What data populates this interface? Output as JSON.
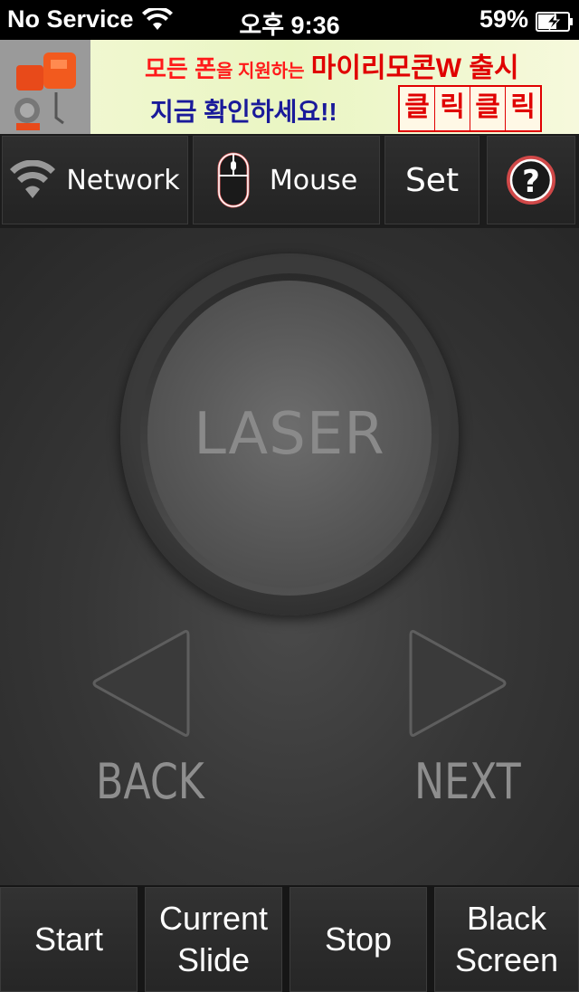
{
  "status_bar": {
    "carrier": "No Service",
    "time": "오후 9:36",
    "battery_pct": "59%"
  },
  "ad": {
    "line1_a": "모든 폰",
    "line1_b": "을 지원하는",
    "line1_c": "마이리모콘W 출시",
    "line2": "지금 확인하세요!!",
    "click_chars": [
      "클",
      "릭",
      "클",
      "릭"
    ]
  },
  "toolbar": {
    "network_label": "Network",
    "mouse_label": "Mouse",
    "set_label": "Set",
    "help_label": "?"
  },
  "laser": {
    "label": "LASER"
  },
  "nav": {
    "back_label": "BACK",
    "next_label": "NEXT"
  },
  "bottom_bar": {
    "start_label": "Start",
    "current_slide_label": "Current\nSlide",
    "stop_label": "Stop",
    "black_screen_label": "Black\nScreen"
  },
  "colors": {
    "accent_red": "#e00000",
    "ad_blue": "#1a1a9a",
    "text_gray": "#8a8a8a"
  }
}
